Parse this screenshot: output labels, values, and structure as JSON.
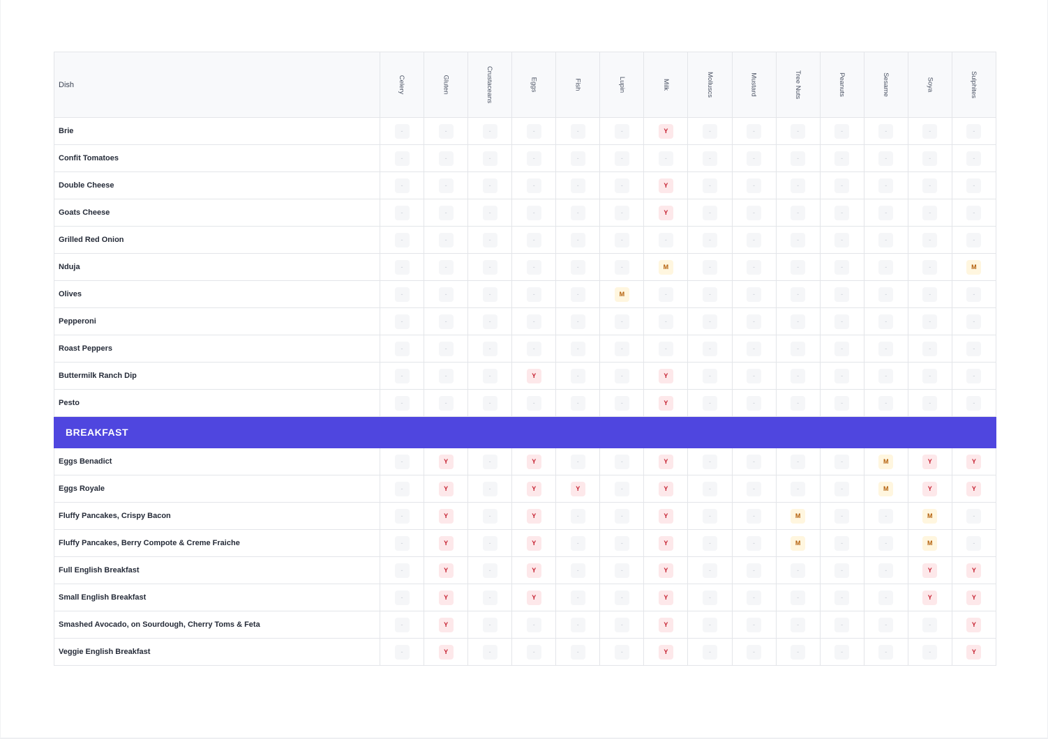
{
  "table": {
    "dish_header": "Dish",
    "allergens": [
      "Celery",
      "Gluten",
      "Crustaceans",
      "Eggs",
      "Fish",
      "Lupin",
      "Milk",
      "Molluscs",
      "Mustard",
      "Tree Nuts",
      "Peanuts",
      "Sesame",
      "Soya",
      "Sulphites"
    ],
    "legend_values": {
      "none": "-",
      "yes": "Y",
      "may": "M"
    },
    "colors": {
      "section_bg": "#4f46df",
      "yes_bg": "#fde8ea",
      "yes_text": "#c51f2f",
      "may_bg": "#fff6df",
      "may_text": "#b35f0a"
    }
  },
  "rows": [
    {
      "type": "dish",
      "name": "Brie",
      "values": [
        "-",
        "-",
        "-",
        "-",
        "-",
        "-",
        "Y",
        "-",
        "-",
        "-",
        "-",
        "-",
        "-",
        "-"
      ]
    },
    {
      "type": "dish",
      "name": "Confit Tomatoes",
      "values": [
        "-",
        "-",
        "-",
        "-",
        "-",
        "-",
        "-",
        "-",
        "-",
        "-",
        "-",
        "-",
        "-",
        "-"
      ]
    },
    {
      "type": "dish",
      "name": "Double Cheese",
      "values": [
        "-",
        "-",
        "-",
        "-",
        "-",
        "-",
        "Y",
        "-",
        "-",
        "-",
        "-",
        "-",
        "-",
        "-"
      ]
    },
    {
      "type": "dish",
      "name": "Goats Cheese",
      "values": [
        "-",
        "-",
        "-",
        "-",
        "-",
        "-",
        "Y",
        "-",
        "-",
        "-",
        "-",
        "-",
        "-",
        "-"
      ]
    },
    {
      "type": "dish",
      "name": "Grilled Red Onion",
      "values": [
        "-",
        "-",
        "-",
        "-",
        "-",
        "-",
        "-",
        "-",
        "-",
        "-",
        "-",
        "-",
        "-",
        "-"
      ]
    },
    {
      "type": "dish",
      "name": "Nduja",
      "values": [
        "-",
        "-",
        "-",
        "-",
        "-",
        "-",
        "M",
        "-",
        "-",
        "-",
        "-",
        "-",
        "-",
        "M"
      ]
    },
    {
      "type": "dish",
      "name": "Olives",
      "values": [
        "-",
        "-",
        "-",
        "-",
        "-",
        "M",
        "-",
        "-",
        "-",
        "-",
        "-",
        "-",
        "-",
        "-"
      ]
    },
    {
      "type": "dish",
      "name": "Pepperoni",
      "values": [
        "-",
        "-",
        "-",
        "-",
        "-",
        "-",
        "-",
        "-",
        "-",
        "-",
        "-",
        "-",
        "-",
        "-"
      ]
    },
    {
      "type": "dish",
      "name": "Roast Peppers",
      "values": [
        "-",
        "-",
        "-",
        "-",
        "-",
        "-",
        "-",
        "-",
        "-",
        "-",
        "-",
        "-",
        "-",
        "-"
      ]
    },
    {
      "type": "dish",
      "name": "Buttermilk Ranch Dip",
      "values": [
        "-",
        "-",
        "-",
        "Y",
        "-",
        "-",
        "Y",
        "-",
        "-",
        "-",
        "-",
        "-",
        "-",
        "-"
      ]
    },
    {
      "type": "dish",
      "name": "Pesto",
      "values": [
        "-",
        "-",
        "-",
        "-",
        "-",
        "-",
        "Y",
        "-",
        "-",
        "-",
        "-",
        "-",
        "-",
        "-"
      ]
    },
    {
      "type": "section",
      "name": "BREAKFAST"
    },
    {
      "type": "dish",
      "name": "Eggs Benadict",
      "values": [
        "-",
        "Y",
        "-",
        "Y",
        "-",
        "-",
        "Y",
        "-",
        "-",
        "-",
        "-",
        "M",
        "Y",
        "Y"
      ]
    },
    {
      "type": "dish",
      "name": "Eggs Royale",
      "values": [
        "-",
        "Y",
        "-",
        "Y",
        "Y",
        "-",
        "Y",
        "-",
        "-",
        "-",
        "-",
        "M",
        "Y",
        "Y"
      ]
    },
    {
      "type": "dish",
      "name": "Fluffy Pancakes, Crispy Bacon",
      "values": [
        "-",
        "Y",
        "-",
        "Y",
        "-",
        "-",
        "Y",
        "-",
        "-",
        "M",
        "-",
        "-",
        "M",
        "-"
      ]
    },
    {
      "type": "dish",
      "name": "Fluffy Pancakes, Berry Compote & Creme Fraiche",
      "values": [
        "-",
        "Y",
        "-",
        "Y",
        "-",
        "-",
        "Y",
        "-",
        "-",
        "M",
        "-",
        "-",
        "M",
        "-"
      ]
    },
    {
      "type": "dish",
      "name": "Full English Breakfast",
      "values": [
        "-",
        "Y",
        "-",
        "Y",
        "-",
        "-",
        "Y",
        "-",
        "-",
        "-",
        "-",
        "-",
        "Y",
        "Y"
      ]
    },
    {
      "type": "dish",
      "name": "Small English Breakfast",
      "values": [
        "-",
        "Y",
        "-",
        "Y",
        "-",
        "-",
        "Y",
        "-",
        "-",
        "-",
        "-",
        "-",
        "Y",
        "Y"
      ]
    },
    {
      "type": "dish",
      "name": "Smashed Avocado, on Sourdough, Cherry Toms & Feta",
      "values": [
        "-",
        "Y",
        "-",
        "-",
        "-",
        "-",
        "Y",
        "-",
        "-",
        "-",
        "-",
        "-",
        "-",
        "Y"
      ]
    },
    {
      "type": "dish",
      "name": "Veggie English Breakfast",
      "values": [
        "-",
        "Y",
        "-",
        "-",
        "-",
        "-",
        "Y",
        "-",
        "-",
        "-",
        "-",
        "-",
        "-",
        "Y"
      ]
    }
  ]
}
